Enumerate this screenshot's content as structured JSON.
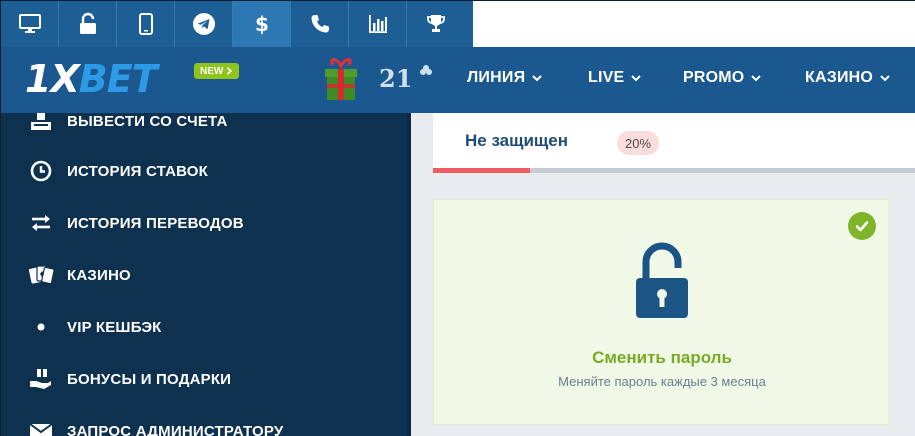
{
  "toolbar": {
    "icons": [
      "desktop-icon",
      "lock-open-icon",
      "mobile-icon",
      "telegram-icon",
      "dollar-icon",
      "phone-icon",
      "stats-icon",
      "trophy-icon"
    ]
  },
  "header": {
    "logo_x": "1X",
    "logo_bet": "BET",
    "new_badge": "NEW",
    "promo_number": "21",
    "nav": [
      {
        "label": "ЛИНИЯ"
      },
      {
        "label": "LIVE"
      },
      {
        "label": "PROMO"
      },
      {
        "label": "КАЗИНО"
      }
    ]
  },
  "sidebar": {
    "items": [
      {
        "label": "ВЫВЕСТИ СО СЧЕТА",
        "icon": "withdraw-icon"
      },
      {
        "label": "ИСТОРИЯ СТАВОК",
        "icon": "clock-icon"
      },
      {
        "label": "ИСТОРИЯ ПЕРЕВОДОВ",
        "icon": "transfer-arrows-icon"
      },
      {
        "label": "КАЗИНО",
        "icon": "cards-icon"
      },
      {
        "label": "VIP КЕШБЭК",
        "icon": "dot-icon"
      },
      {
        "label": "БОНУСЫ И ПОДАРКИ",
        "icon": "gift-hand-icon"
      },
      {
        "label": "ЗАПРОС АДМИНИСТРАТОРУ",
        "icon": "envelope-icon"
      }
    ]
  },
  "security": {
    "status": "Не защищен",
    "percent_label": "20%",
    "progress": 0.2
  },
  "password_card": {
    "title": "Сменить пароль",
    "subtitle": "Меняйте пароль каждые 3 месяца"
  },
  "colors": {
    "toolbar_bg": "#1d5f95",
    "nav_bg": "#1b5890",
    "sidebar_bg": "#0f3150",
    "accent_green": "#7aa924",
    "progress_red": "#ef5a5f"
  }
}
